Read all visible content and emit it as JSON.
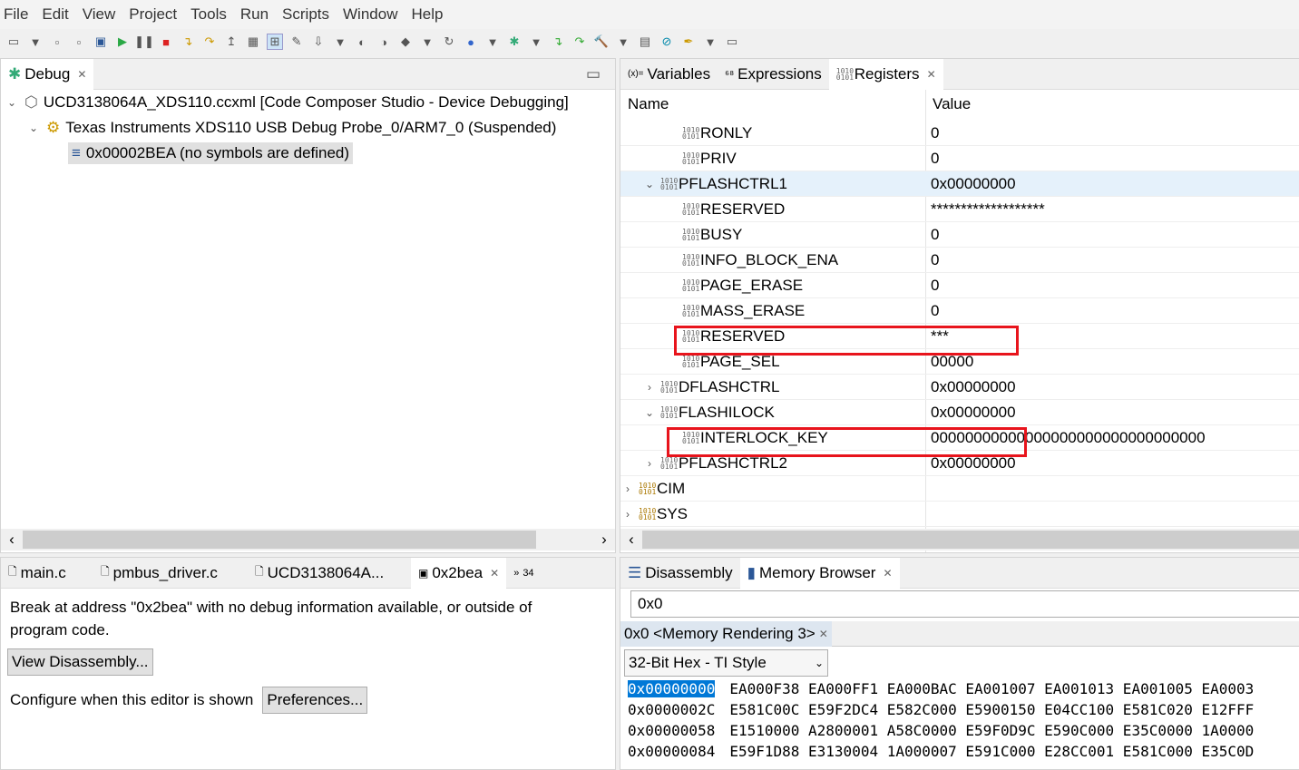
{
  "menu": [
    "File",
    "Edit",
    "View",
    "Project",
    "Tools",
    "Run",
    "Scripts",
    "Window",
    "Help"
  ],
  "debug": {
    "tab": "Debug",
    "session": "UCD3138064A_XDS110.ccxml [Code Composer Studio - Device Debugging]",
    "probe": "Texas Instruments XDS110 USB Debug Probe_0/ARM7_0 (Suspended)",
    "frame": "0x00002BEA  (no symbols are defined)"
  },
  "regs": {
    "tabs": [
      "Variables",
      "Expressions",
      "Registers"
    ],
    "col_name": "Name",
    "col_value": "Value",
    "rows": [
      {
        "name": "RONLY",
        "value": "0"
      },
      {
        "name": "PRIV",
        "value": "0"
      },
      {
        "name": "PFLASHCTRL1",
        "value": "0x00000000"
      },
      {
        "name": "RESERVED",
        "value": "*******************"
      },
      {
        "name": "BUSY",
        "value": "0"
      },
      {
        "name": "INFO_BLOCK_ENA",
        "value": "0"
      },
      {
        "name": "PAGE_ERASE",
        "value": "0"
      },
      {
        "name": "MASS_ERASE",
        "value": "0"
      },
      {
        "name": "RESERVED",
        "value": "***"
      },
      {
        "name": "PAGE_SEL",
        "value": "00000"
      },
      {
        "name": "DFLASHCTRL",
        "value": "0x00000000"
      },
      {
        "name": "FLASHILOCK",
        "value": "0x00000000"
      },
      {
        "name": "INTERLOCK_KEY",
        "value": "00000000000000000000000000000000"
      },
      {
        "name": "PFLASHCTRL2",
        "value": "0x00000000"
      },
      {
        "name": "CIM",
        "value": ""
      },
      {
        "name": "SYS",
        "value": ""
      }
    ]
  },
  "editor": {
    "tabs": [
      "main.c",
      "pmbus_driver.c",
      "UCD3138064A...",
      "0x2bea"
    ],
    "overflow": "34",
    "message": "Break at address \"0x2bea\" with no debug information available, or outside of program code.",
    "view_disassembly": "View Disassembly...",
    "configure": "Configure when this editor is shown",
    "preferences": "Preferences..."
  },
  "memory": {
    "tabs": [
      "Disassembly",
      "Memory Browser"
    ],
    "address": "0x0",
    "rendering_tab": "0x0 <Memory Rendering 3>",
    "format": "32-Bit Hex - TI Style",
    "rows": [
      {
        "addr": "0x00000000",
        "words": "EA000F38 EA000FF1 EA000BAC EA001007 EA001013 EA001005 EA0003"
      },
      {
        "addr": "0x0000002C",
        "words": "E581C00C E59F2DC4 E582C000 E5900150 E04CC100 E581C020 E12FFF"
      },
      {
        "addr": "0x00000058",
        "words": "E1510000 A2800001 A58C0000 E59F0D9C E590C000 E35C0000 1A0000"
      },
      {
        "addr": "0x00000084",
        "words": "E59F1D88 E3130004 1A000007 E591C000 E28CC001 E581C000 E35C0D"
      }
    ]
  },
  "colors": {
    "highlight": "#e8141c",
    "selection": "#0078d7"
  }
}
